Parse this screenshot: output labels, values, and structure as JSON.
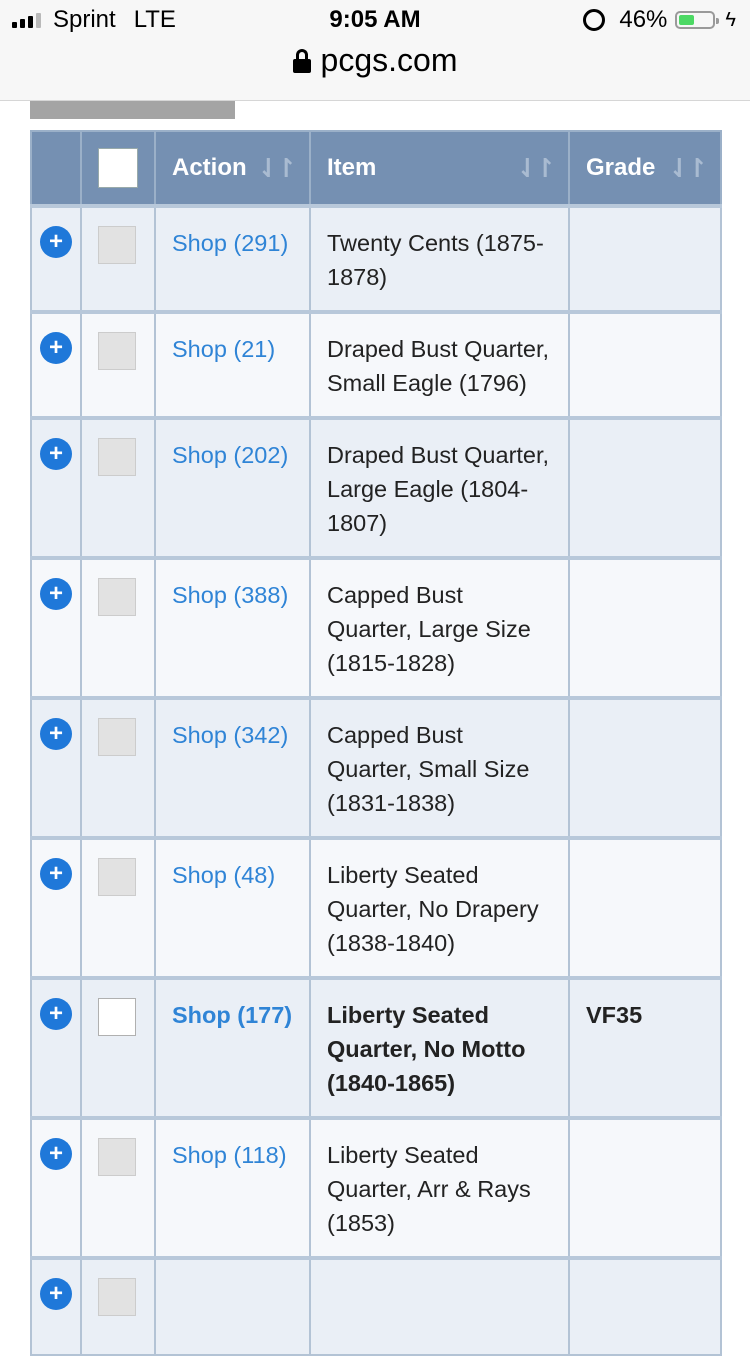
{
  "statusbar": {
    "carrier": "Sprint",
    "network": "LTE",
    "time": "9:05 AM",
    "battery": "46%",
    "battery_level": 0.46,
    "url": "pcgs.com"
  },
  "table": {
    "headers": {
      "action": "Action",
      "item": "Item",
      "grade": "Grade"
    },
    "rows": [
      {
        "shop": "Shop (291)",
        "item": "Twenty Cents (1875-1878)",
        "grade": "",
        "selected": false
      },
      {
        "shop": "Shop (21)",
        "item": "Draped Bust Quarter, Small Eagle (1796)",
        "grade": "",
        "selected": false
      },
      {
        "shop": "Shop (202)",
        "item": "Draped Bust Quarter, Large Eagle (1804-1807)",
        "grade": "",
        "selected": false
      },
      {
        "shop": "Shop (388)",
        "item": "Capped Bust Quarter, Large Size (1815-1828)",
        "grade": "",
        "selected": false
      },
      {
        "shop": "Shop (342)",
        "item": "Capped Bust Quarter, Small Size (1831-1838)",
        "grade": "",
        "selected": false
      },
      {
        "shop": "Shop (48)",
        "item": "Liberty Seated Quarter, No Drapery (1838-1840)",
        "grade": "",
        "selected": false
      },
      {
        "shop": "Shop (177)",
        "item": "Liberty Seated Quarter, No Motto (1840-1865)",
        "grade": "VF35",
        "selected": true
      },
      {
        "shop": "Shop (118)",
        "item": "Liberty Seated Quarter, Arr & Rays (1853)",
        "grade": "",
        "selected": false
      }
    ]
  }
}
